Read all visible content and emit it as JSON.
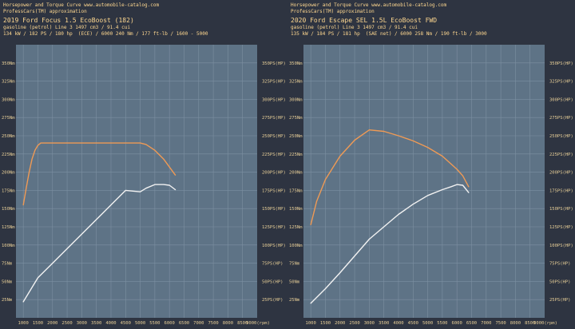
{
  "colors": {
    "page_bg": "#2e3441",
    "plot_bg": "#5e7386",
    "grid": "#7d90a2",
    "header_text": "#ffd890",
    "axis_text": "#e8cf98",
    "torque": "#ef9a55",
    "power": "#f2f2f2"
  },
  "panels": [
    {
      "header1": "Horsepower and Torque Curve www.automobile-catalog.com",
      "header2": "ProfessCars(TM) approximation",
      "model": "2019 Ford Focus 1.5 EcoBoost (182)",
      "specs1": "gasoline (petrol) Line 3 1497 cm3 / 91.4 cui",
      "specs2": "134 kW / 182 PS / 180 hp  (ECE) / 6000 240 Nm / 177 ft-lb / 1600 - 5000"
    },
    {
      "header1": "Horsepower and Torque Curve www.automobile-catalog.com",
      "header2": "ProfessCars(TM) approximation",
      "model": "2020 Ford Escape SEL 1.5L EcoBoost FWD",
      "specs1": "gasoline (petrol) Line 3 1497 cm3 / 91.4 cui",
      "specs2": "135 kW / 184 PS / 181 hp  (SAE net) / 6000 258 Nm / 190 ft-lb / 3000"
    }
  ],
  "chart_data": [
    {
      "type": "line",
      "xlim": [
        750,
        9000
      ],
      "ylim": [
        0,
        375
      ],
      "x_ticks": [
        1000,
        1500,
        2000,
        2500,
        3000,
        3500,
        4000,
        4500,
        5000,
        5500,
        6000,
        6500,
        7000,
        7500,
        8000,
        8500
      ],
      "x_tick_labels": [
        "1000",
        "1500",
        "2000",
        "2500",
        "3000",
        "3500",
        "4000",
        "4500",
        "5000",
        "5500",
        "6000",
        "6500",
        "7000",
        "7500",
        "8000",
        "8500"
      ],
      "x_end_label": "9000(rpm)",
      "y_ticks": [
        25,
        50,
        75,
        100,
        125,
        150,
        175,
        200,
        225,
        250,
        275,
        300,
        325,
        350
      ],
      "left_tick_labels": [
        "25Nm",
        "50Nm",
        "75Nm",
        "100Nm",
        "125Nm",
        "150Nm",
        "175Nm",
        "200Nm",
        "225Nm",
        "250Nm",
        "275Nm",
        "300Nm",
        "325Nm",
        "350Nm"
      ],
      "right_tick_labels": [
        "25PS(HP)",
        "50PS(HP)",
        "75PS(HP)",
        "100PS(HP)",
        "125PS(HP)",
        "150PS(HP)",
        "175PS(HP)",
        "200PS(HP)",
        "225PS(HP)",
        "250PS(HP)",
        "275PS(HP)",
        "300PS(HP)",
        "325PS(HP)",
        "350PS(HP)"
      ],
      "series": [
        {
          "key": "torque",
          "x": [
            1000,
            1100,
            1200,
            1300,
            1400,
            1500,
            1600,
            2000,
            3000,
            4000,
            5000,
            5200,
            5500,
            5800,
            6000,
            6200
          ],
          "y": [
            155,
            178,
            200,
            218,
            230,
            237,
            240,
            240,
            240,
            240,
            240,
            238,
            230,
            218,
            207,
            196
          ]
        },
        {
          "key": "power",
          "x": [
            1000,
            1500,
            2000,
            2500,
            3000,
            3500,
            4000,
            4500,
            5000,
            5200,
            5500,
            5800,
            6000,
            6200
          ],
          "y": [
            22,
            55,
            75,
            95,
            115,
            135,
            155,
            175,
            173,
            178,
            183,
            183,
            182,
            176
          ]
        }
      ]
    },
    {
      "type": "line",
      "xlim": [
        750,
        9000
      ],
      "ylim": [
        0,
        375
      ],
      "x_ticks": [
        1000,
        1500,
        2000,
        2500,
        3000,
        3500,
        4000,
        4500,
        5000,
        5500,
        6000,
        6500,
        7000,
        7500,
        8000,
        8500
      ],
      "x_tick_labels": [
        "1000",
        "1500",
        "2000",
        "2500",
        "3000",
        "3500",
        "4000",
        "4500",
        "5000",
        "5500",
        "6000",
        "6500",
        "7000",
        "7500",
        "8000",
        "8500"
      ],
      "x_end_label": "9000(rpm)",
      "y_ticks": [
        25,
        50,
        75,
        100,
        125,
        150,
        175,
        200,
        225,
        250,
        275,
        300,
        325,
        350
      ],
      "left_tick_labels": [
        "25Nm",
        "50Nm",
        "75Nm",
        "100Nm",
        "125Nm",
        "150Nm",
        "175Nm",
        "200Nm",
        "225Nm",
        "250Nm",
        "275Nm",
        "300Nm",
        "325Nm",
        "350Nm"
      ],
      "right_tick_labels": [
        "25PS(HP)",
        "50PS(HP)",
        "75PS(HP)",
        "100PS(HP)",
        "125PS(HP)",
        "150PS(HP)",
        "175PS(HP)",
        "200PS(HP)",
        "225PS(HP)",
        "250PS(HP)",
        "275PS(HP)",
        "300PS(HP)",
        "325PS(HP)",
        "350PS(HP)"
      ],
      "series": [
        {
          "key": "torque",
          "x": [
            1000,
            1200,
            1500,
            2000,
            2500,
            3000,
            3500,
            4000,
            4500,
            5000,
            5500,
            6000,
            6200,
            6400
          ],
          "y": [
            128,
            160,
            190,
            222,
            244,
            258,
            256,
            250,
            243,
            234,
            222,
            204,
            195,
            180
          ]
        },
        {
          "key": "power",
          "x": [
            1000,
            1500,
            2000,
            2500,
            3000,
            3500,
            4000,
            4500,
            5000,
            5500,
            5800,
            6000,
            6200,
            6400
          ],
          "y": [
            20,
            40,
            62,
            85,
            108,
            125,
            142,
            156,
            168,
            176,
            180,
            183,
            182,
            172
          ]
        }
      ]
    }
  ]
}
